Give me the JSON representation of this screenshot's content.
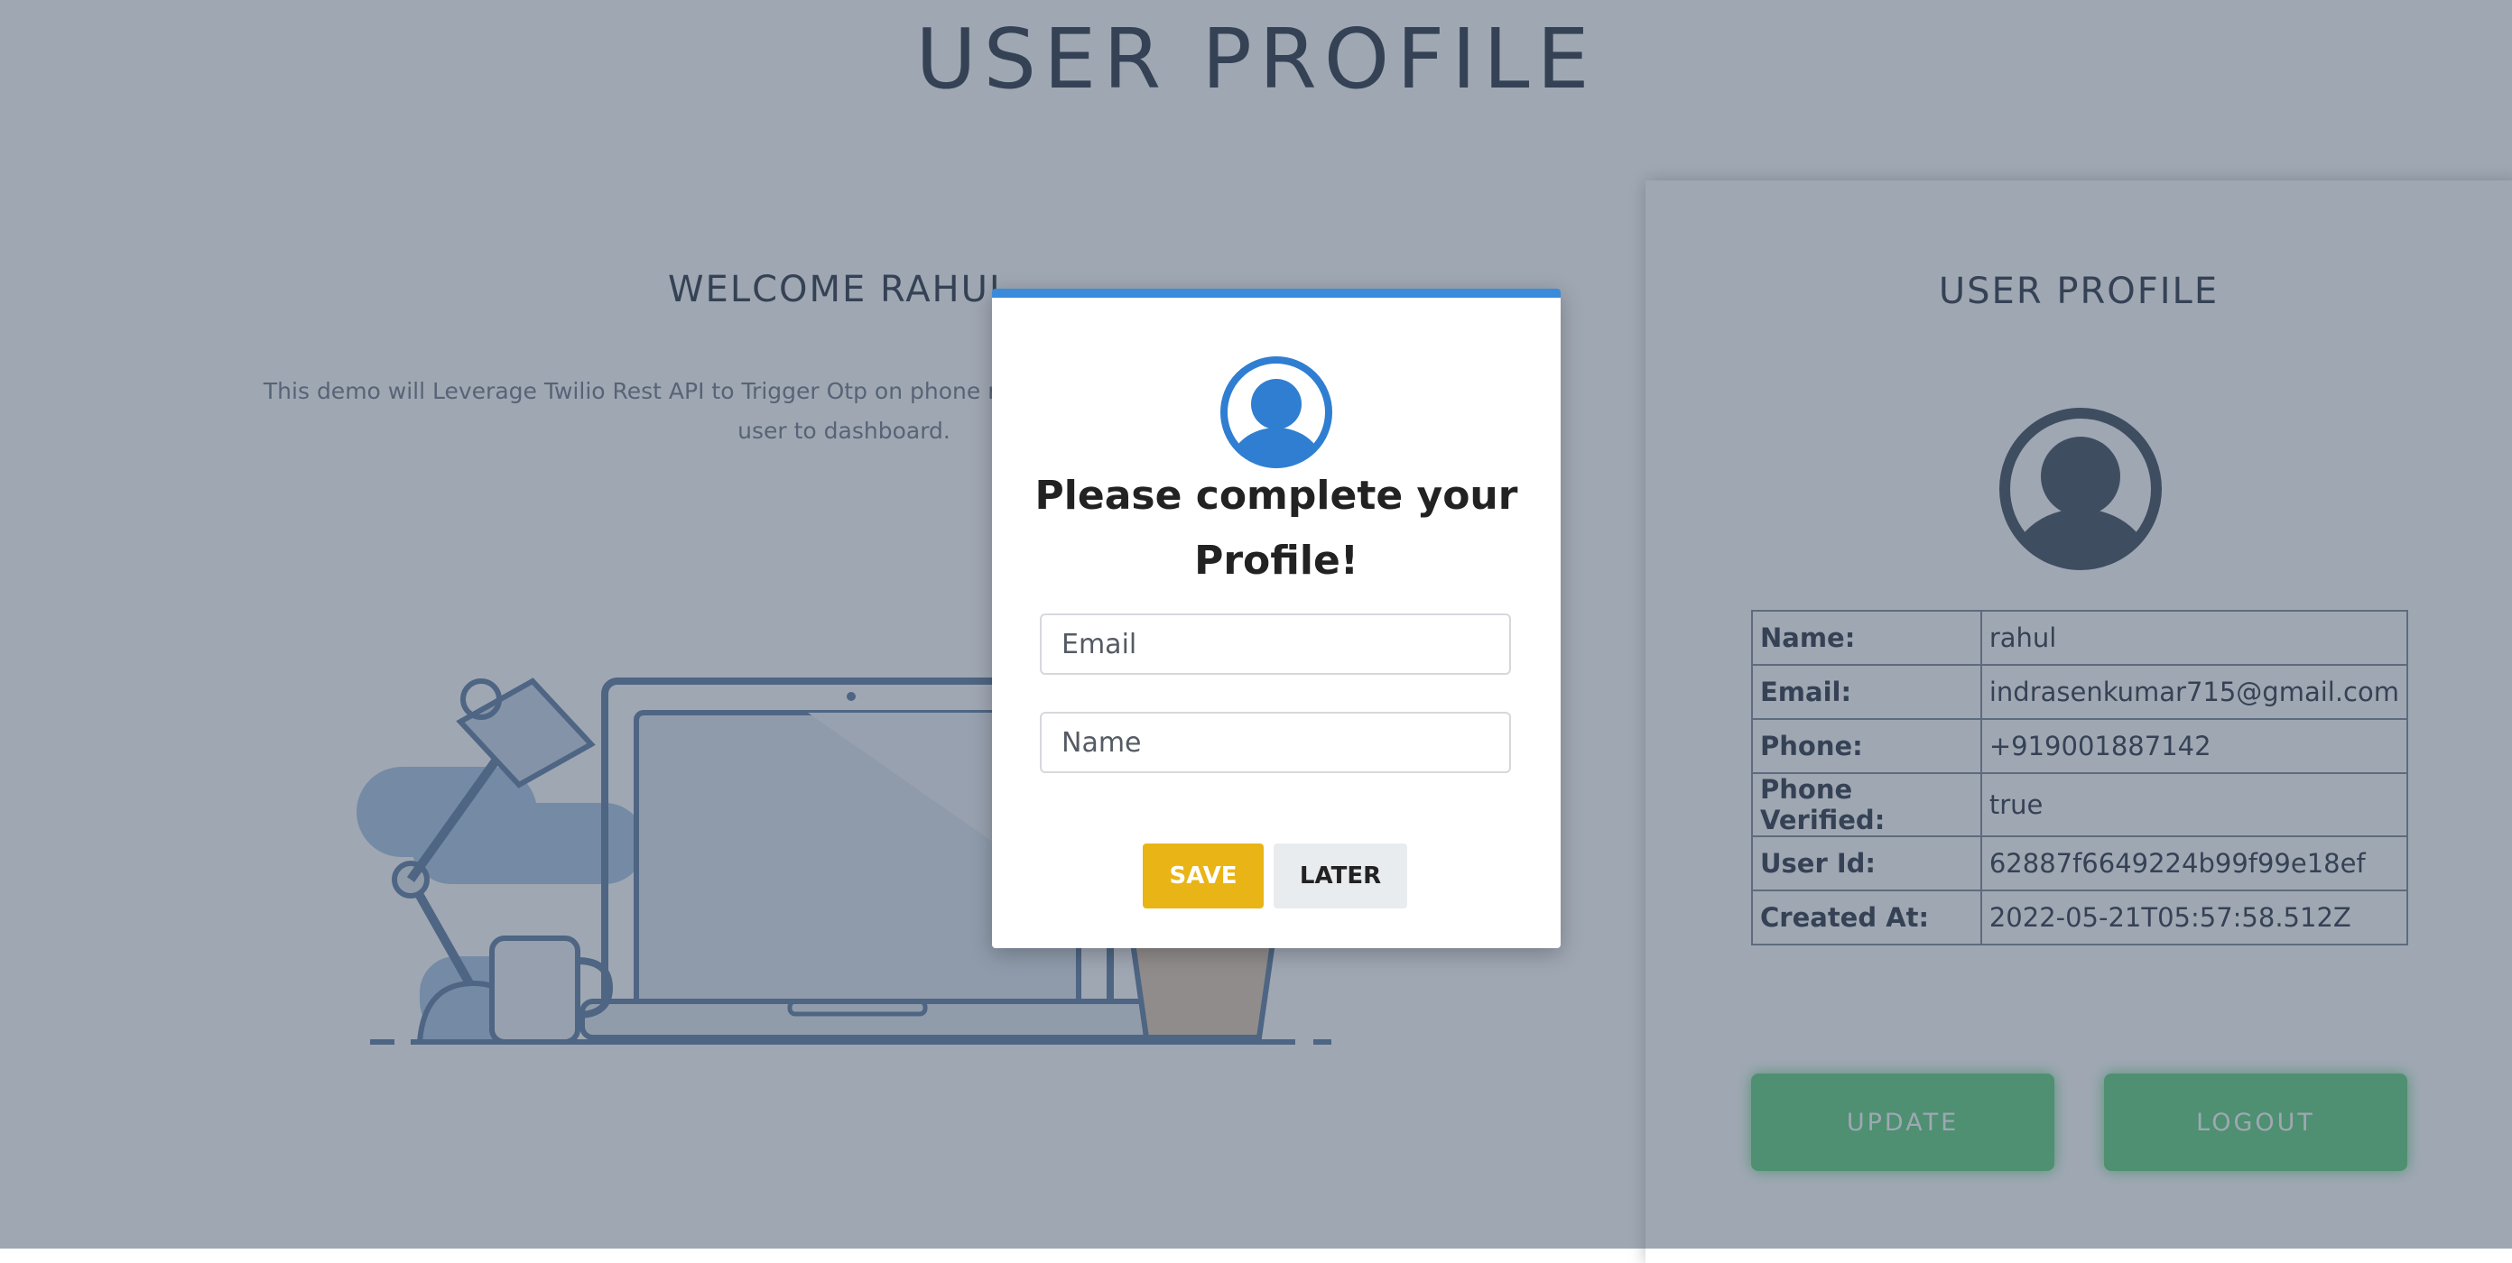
{
  "page": {
    "title": "USER PROFILE"
  },
  "welcome": {
    "greeting": "WELCOME  RAHUL",
    "description_line1": "This demo will Leverage Twilio Rest API to Trigger Otp on phone no,this otp will be verified and redirect",
    "description_line2": "user to dashboard."
  },
  "profile_card": {
    "title": "USER PROFILE",
    "avatar_icon": "user-circle-icon",
    "rows": [
      {
        "label": "Name:",
        "value": "rahul"
      },
      {
        "label": "Email:",
        "value": "indrasenkumar715@gmail.com"
      },
      {
        "label": "Phone:",
        "value": "+919001887142"
      },
      {
        "label": "Phone Verified:",
        "value": "true"
      },
      {
        "label": "User Id:",
        "value": "62887f6649224b99f99e18ef"
      },
      {
        "label": "Created At:",
        "value": "2022-05-21T05:57:58.512Z"
      }
    ],
    "update_label": "UPDATE",
    "logout_label": "LOGOUT"
  },
  "modal": {
    "icon": "user-circle-icon",
    "heading_line1": "Please complete your",
    "heading_line2": "Profile!",
    "email_placeholder": "Email",
    "name_placeholder": "Name",
    "save_label": "SAVE",
    "later_label": "LATER"
  },
  "colors": {
    "modal_accent": "#3a8bdc",
    "save_button": "#e9b416",
    "green_button": "#5cd17a",
    "overlay": "rgba(64,80,103,0.5)"
  }
}
